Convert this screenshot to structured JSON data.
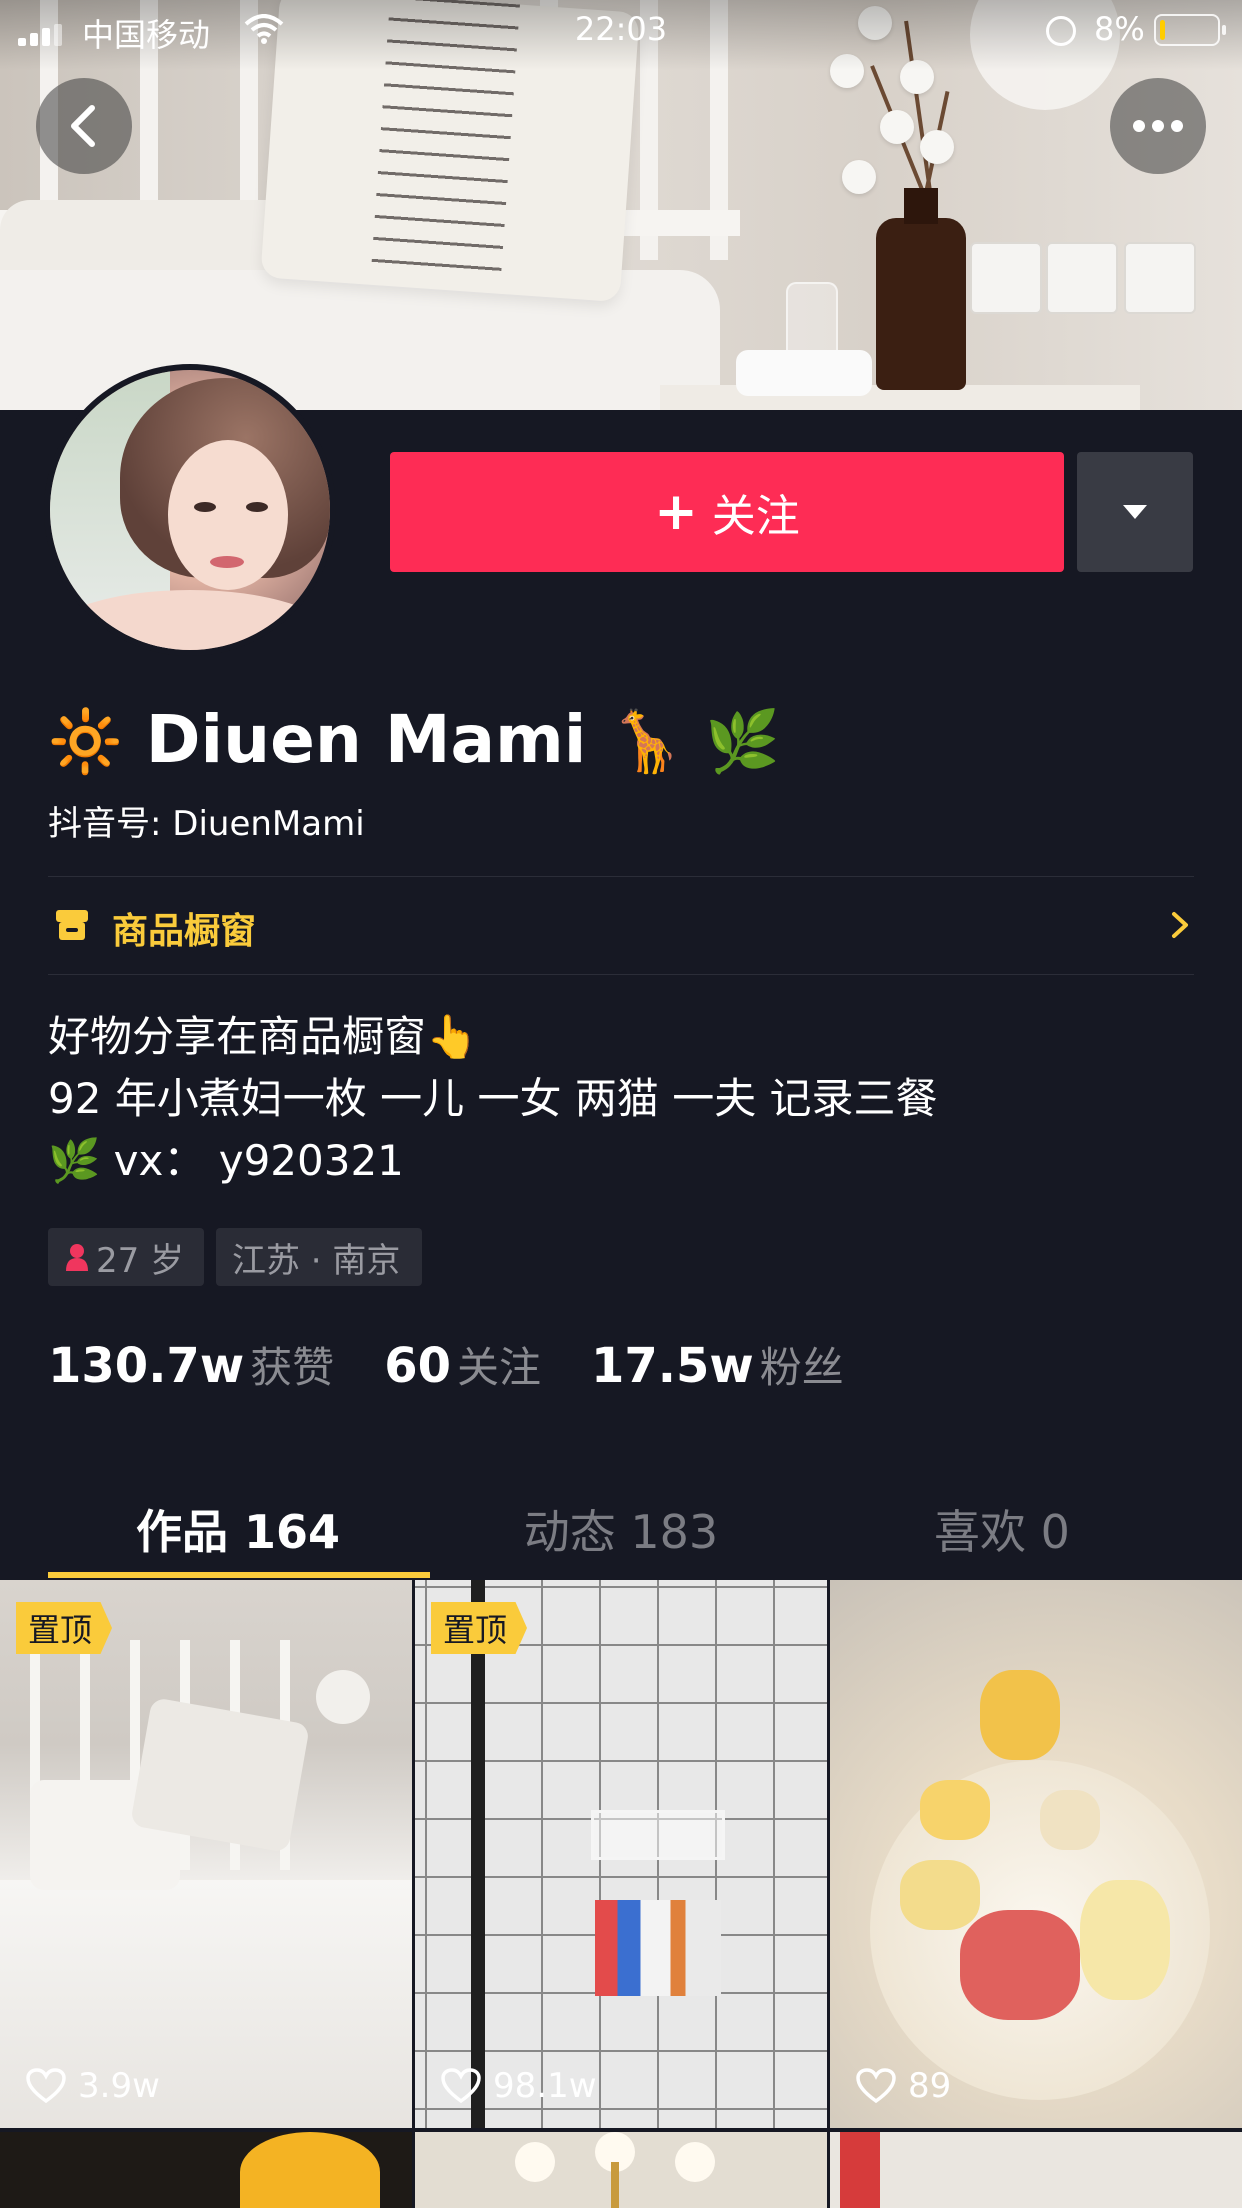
{
  "status_bar": {
    "carrier": "中国移动",
    "time": "22:03",
    "battery_percent": "8%",
    "battery_level": 0.08
  },
  "profile": {
    "name": "Diuen Mami",
    "name_prefix_emoji": "🔆",
    "name_suffix_emojis": "🦒 🌿",
    "douyin_id": "抖音号: DiuenMami",
    "follow_button": "关注",
    "shop_window": "商品橱窗",
    "bio": [
      "好物分享在商品橱窗👆",
      "92 年小煮妇一枚 一儿 一女 两猫 一夫 记录三餐",
      "🌿 vx：  y920321"
    ],
    "tags": {
      "age": "27 岁",
      "location": "江苏 · 南京"
    },
    "stats": [
      {
        "value": "130.7w",
        "label": "获赞"
      },
      {
        "value": "60",
        "label": "关注"
      },
      {
        "value": "17.5w",
        "label": "粉丝"
      }
    ]
  },
  "tabs": [
    {
      "label": "作品 164",
      "active": true
    },
    {
      "label": "动态 183",
      "active": false
    },
    {
      "label": "喜欢 0",
      "active": false
    }
  ],
  "videos": [
    {
      "pinned_label": "置顶",
      "likes": "3.9w"
    },
    {
      "pinned_label": "置顶",
      "likes": "98.1w"
    },
    {
      "pinned_label": "",
      "likes": "89"
    }
  ],
  "colors": {
    "background": "#161823",
    "accent_red": "#fe2c55",
    "accent_yellow": "#facb3b"
  },
  "icons": {
    "back": "chevron-left-icon",
    "more": "more-dots-icon",
    "dropdown": "triangle-down-icon",
    "shop": "shop-icon",
    "arrow": "chevron-right-icon",
    "gender": "female-icon",
    "like": "heart-icon"
  }
}
